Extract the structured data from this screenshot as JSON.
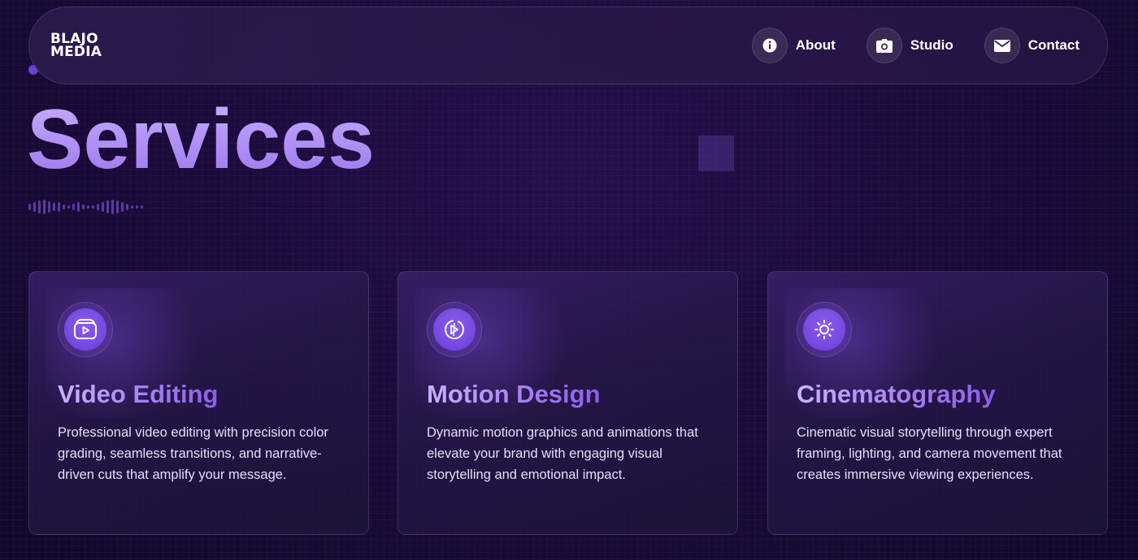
{
  "nav": {
    "logo_line1": "BLAJO",
    "logo_line2": "MEDIA",
    "links": [
      {
        "label": "About",
        "icon": "info-icon"
      },
      {
        "label": "Studio",
        "icon": "camera-icon"
      },
      {
        "label": "Contact",
        "icon": "mail-icon"
      }
    ]
  },
  "hero": {
    "title": "Services"
  },
  "services": [
    {
      "title": "Video Editing",
      "description": "Professional video editing with precision color grading, seamless transitions, and narrative-driven cuts that amplify your message.",
      "icon": "video-editing-icon"
    },
    {
      "title": "Motion Design",
      "description": "Dynamic motion graphics and animations that elevate your brand with engaging visual storytelling and emotional impact.",
      "icon": "motion-design-icon"
    },
    {
      "title": "Cinematography",
      "description": "Cinematic visual storytelling through expert framing, lighting, and camera movement that creates immersive viewing experiences.",
      "icon": "sun-icon"
    }
  ],
  "colors": {
    "background": "#190a38",
    "accent": "#8a5df0",
    "title_gradient_start": "#c9b0ff",
    "title_gradient_end": "#9b74ec"
  }
}
